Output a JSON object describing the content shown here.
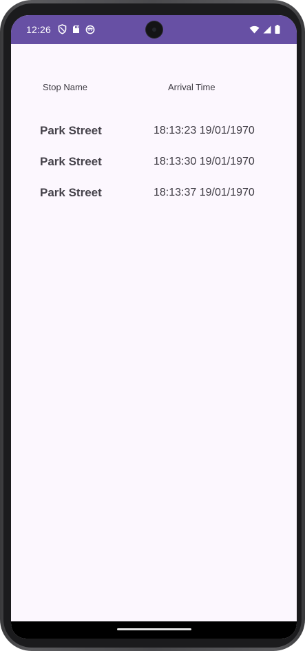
{
  "status_bar": {
    "time": "12:26",
    "background_color": "#6750a4",
    "left_icons": [
      "shield-icon",
      "sd-card-icon",
      "face-icon"
    ],
    "right_icons": [
      "wifi-icon",
      "signal-icon",
      "battery-icon"
    ]
  },
  "table": {
    "headers": {
      "stop_name": "Stop Name",
      "arrival_time": "Arrival Time"
    },
    "rows": [
      {
        "stop": "Park Street",
        "time": "18:13:23 19/01/1970"
      },
      {
        "stop": "Park Street",
        "time": "18:13:30 19/01/1970"
      },
      {
        "stop": "Park Street",
        "time": "18:13:37 19/01/1970"
      }
    ]
  },
  "colors": {
    "accent": "#6750a4",
    "background": "#fcf7fe"
  }
}
